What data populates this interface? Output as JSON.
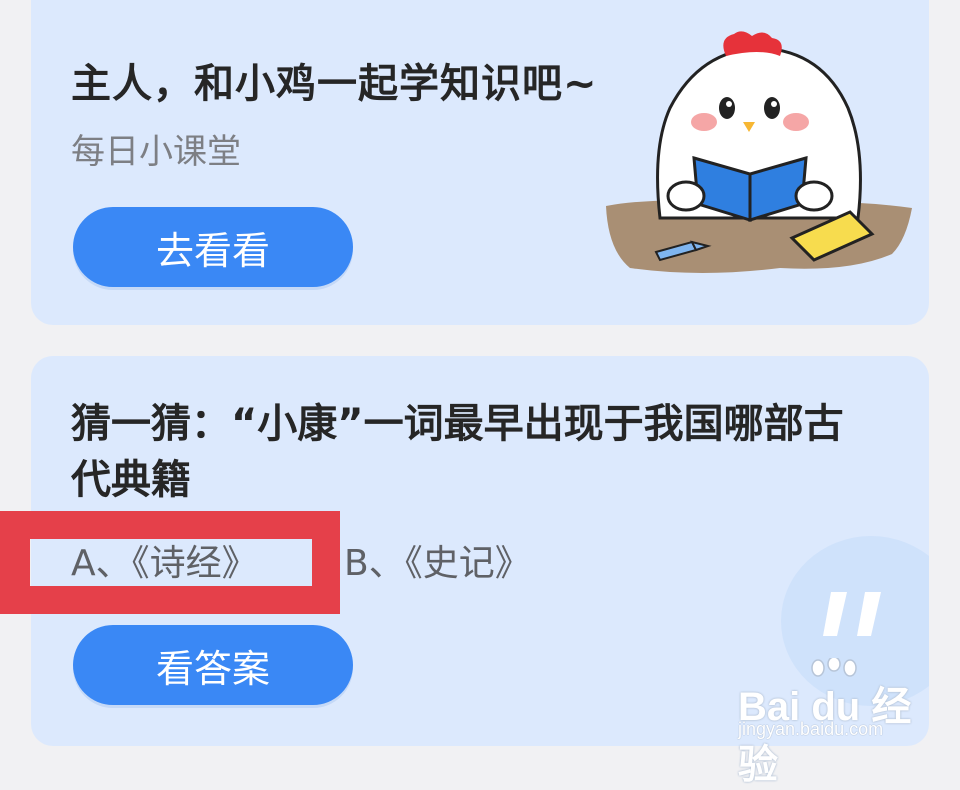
{
  "lesson_card": {
    "title": "主人，和小鸡一起学知识吧~",
    "subtitle": "每日小课堂",
    "button_label": "去看看"
  },
  "quiz_card": {
    "question": "猜一猜：“小康”一词最早出现于我国哪部古代典籍",
    "option_a": "A、《诗经》",
    "option_b": "B、《史记》",
    "button_label": "看答案"
  },
  "watermark": {
    "logo": "Bai du 经验",
    "url": "jingyan.baidu.com"
  },
  "colors": {
    "card_background": "#dce9fd",
    "page_background": "#f1f1f3",
    "button_blue": "#3a88f5",
    "highlight_red": "#e5404a"
  },
  "icons": {
    "mascot": "chicken-reading-book-illustration",
    "quote_bubble": "quote-bubble-icon",
    "paw": "baidu-paw-logo"
  }
}
